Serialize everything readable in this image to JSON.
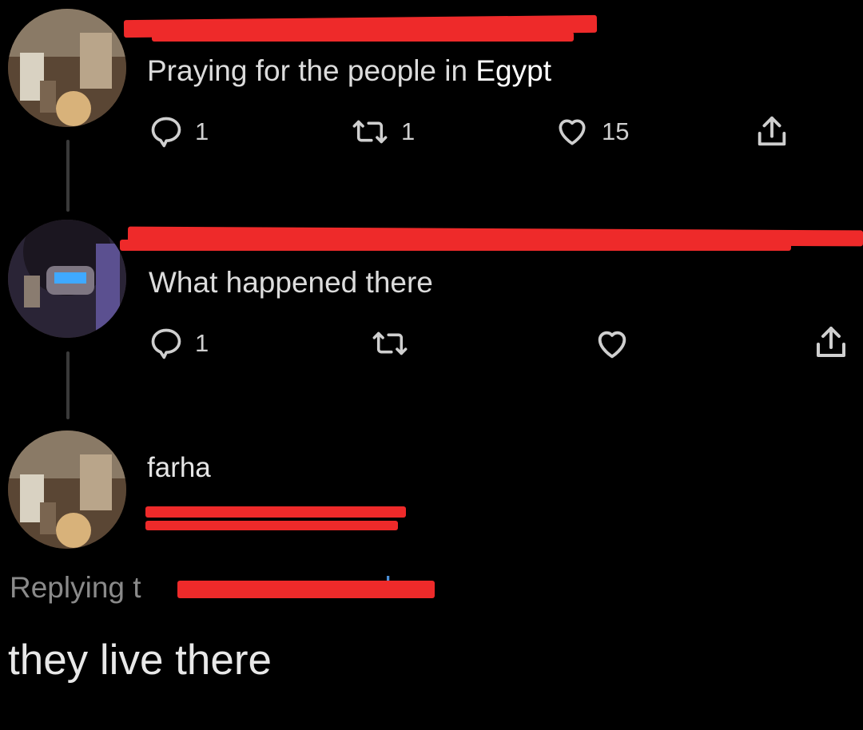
{
  "tweet1": {
    "text": "Praying for the people in",
    "highlight": "Egypt",
    "replies": "1",
    "retweets": "1",
    "likes": "15"
  },
  "tweet2": {
    "text": "What happened there",
    "replies": "1"
  },
  "tweet3": {
    "display_name": "farha",
    "replying_prefix": "Replying t",
    "replying_suffix": "k",
    "text": "they live there"
  },
  "icons": {
    "reply": "speech-bubble-icon",
    "retweet": "retweet-arrows-icon",
    "like": "heart-icon",
    "share": "share-upload-icon"
  },
  "colors": {
    "background": "#000000",
    "redaction": "#ee2a2a",
    "link": "#4c8fd6"
  }
}
